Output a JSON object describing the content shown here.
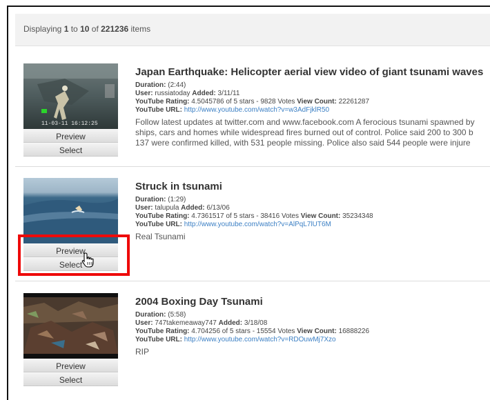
{
  "header": {
    "prefix": "Displaying ",
    "from": "1",
    "middle": " to ",
    "to": "10",
    "of_text": " of ",
    "total": "221236",
    "suffix": " items"
  },
  "labels": {
    "duration": "Duration:",
    "user": "User:",
    "added": "Added:",
    "rating": "YouTube Rating:",
    "view_count": "View Count:",
    "url": "YouTube URL:"
  },
  "items": [
    {
      "title": "Japan Earthquake: Helicopter aerial view video of giant tsunami waves",
      "duration": "(2:44)",
      "user": "russiatoday",
      "added": "3/11/11",
      "rating": "4.5045786 of 5 stars - 9828 Votes",
      "views": "22261287",
      "url": "http://www.youtube.com/watch?v=w3AdFjklR50",
      "desc_lines": [
        "Follow latest updates at twitter.com and www.facebook.com A ferocious tsunami spawned by",
        "ships, cars and homes while widespread fires burned out of control. Police said 200 to 300 b",
        "137 were confirmed killed, with 531 people missing. Police also said 544 people were injure"
      ],
      "thumb_timestamp": "11-03-11 16:12:25",
      "preview_label": "Preview",
      "select_label": "Select"
    },
    {
      "title": "Struck in tsunami",
      "duration": "(1:29)",
      "user": "talupula",
      "added": "6/13/06",
      "rating": "4.7361517 of 5 stars - 38416 Votes",
      "views": "35234348",
      "url": "http://www.youtube.com/watch?v=AlPqL7lUT6M",
      "desc_lines": [
        "Real Tsunami"
      ],
      "preview_label": "Preview",
      "select_label": "Select"
    },
    {
      "title": "2004 Boxing Day Tsunami",
      "duration": "(5:58)",
      "user": "747takemeaway747",
      "added": "3/18/08",
      "rating": "4.704256 of 5 stars - 15554 Votes",
      "views": "16888226",
      "url": "http://www.youtube.com/watch?v=RDOuwMj7Xzo",
      "desc_lines": [
        "RIP"
      ],
      "preview_label": "Preview",
      "select_label": "Select"
    }
  ],
  "colors": {
    "link": "#3b7fc4",
    "highlight": "#ee0a0a"
  }
}
